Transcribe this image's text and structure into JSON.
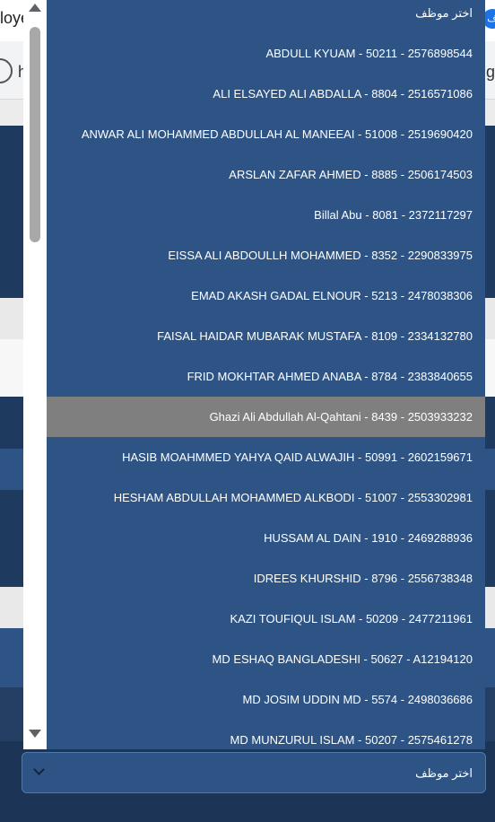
{
  "background": {
    "tab_fragment": "loye",
    "tab_badge": "ف",
    "address_left": "h",
    "address_right": "g"
  },
  "dropdown": {
    "placeholder": "اختر موظف",
    "highlighted_index": 10,
    "options": [
      "اختر موظف",
      "ABDULL KYUAM - 50211 - 2576898544",
      "ALI ELSAYED ALI ABDALLA - 8804 - 2516571086",
      "ANWAR ALI MOHAMMED ABDULLAH AL MANEEAI - 51008 - 2519690420",
      "ARSLAN ZAFAR AHMED - 8885 - 2506174503",
      "Billal Abu - 8081 - 2372117297",
      "EISSA ALI ABDOULLH MOHAMMED - 8352 - 2290833975",
      "EMAD AKASH GADAL ELNOUR - 5213 - 2478038306",
      "FAISAL HAIDAR MUBARAK MUSTAFA - 8109 - 2334132780",
      "FRID MOKHTAR AHMED ANABA - 8784 - 2383840655",
      "Ghazi Ali Abdullah Al-Qahtani - 8439 - 2503933232",
      "HASIB MOAHMMED YAHYA QAID ALWAJIH - 50991 - 2602159671",
      "HESHAM ABDULLAH MOHAMMED ALKBODI - 51007 - 2553302981",
      "HUSSAM AL DAIN - 1910 - 2469288936",
      "IDREES KHURSHID - 8796 - 2556738348",
      "KAZI TOUFIQUL ISLAM - 50209 - 2477211961",
      "MD ESHAQ BANGLADESHI - 50627 - A12194120",
      "MD JOSIM UDDIN MD - 5574 - 2498036686",
      "MD MUNZURUL ISLAM - 50207 - 2575461278"
    ]
  },
  "select": {
    "value": "اختر موظف"
  },
  "colors": {
    "list_background": "#2d5485",
    "highlight": "#7f7f7f",
    "text": "#ffffff"
  }
}
